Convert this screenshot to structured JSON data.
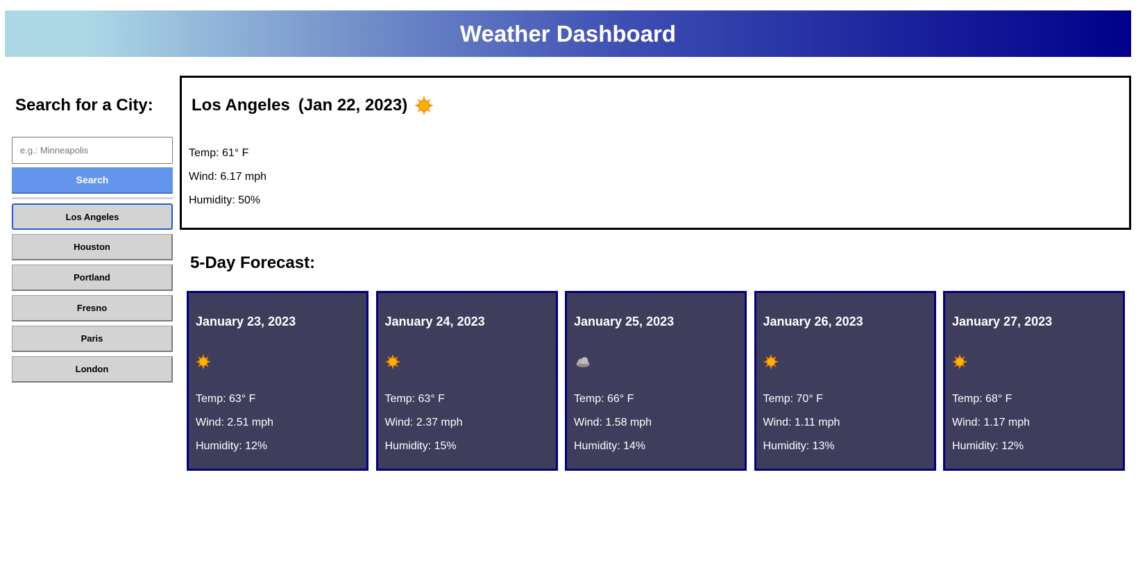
{
  "header": {
    "title": "Weather Dashboard"
  },
  "sidebar": {
    "heading": "Search for a City:",
    "search_placeholder": "e.g.: Minneapolis",
    "search_value": "",
    "search_button": "Search",
    "cities": [
      "Los Angeles",
      "Houston",
      "Portland",
      "Fresno",
      "Paris",
      "London"
    ],
    "active_city": "Los Angeles"
  },
  "current": {
    "city": "Los Angeles",
    "date": "(Jan 22, 2023)",
    "icon": "sun-icon",
    "temp": "Temp: 61° F",
    "wind": "Wind: 6.17 mph",
    "humidity": "Humidity: 50%"
  },
  "forecast": {
    "heading": "5-Day Forecast:",
    "days": [
      {
        "date": "January 23, 2023",
        "icon": "sun-icon",
        "temp": "Temp: 63° F",
        "wind": "Wind: 2.51 mph",
        "humidity": "Humidity: 12%"
      },
      {
        "date": "January 24, 2023",
        "icon": "sun-icon",
        "temp": "Temp: 63° F",
        "wind": "Wind: 2.37 mph",
        "humidity": "Humidity: 15%"
      },
      {
        "date": "January 25, 2023",
        "icon": "cloud-icon",
        "temp": "Temp: 66° F",
        "wind": "Wind: 1.58 mph",
        "humidity": "Humidity: 14%"
      },
      {
        "date": "January 26, 2023",
        "icon": "sun-icon",
        "temp": "Temp: 70° F",
        "wind": "Wind: 1.11 mph",
        "humidity": "Humidity: 13%"
      },
      {
        "date": "January 27, 2023",
        "icon": "sun-icon",
        "temp": "Temp: 68° F",
        "wind": "Wind: 1.17 mph",
        "humidity": "Humidity: 12%"
      }
    ]
  },
  "colors": {
    "search_button": "#6495ed",
    "card_background": "#3e3e5c",
    "card_border": "#000080",
    "header_gradient_start": "#add8e6",
    "header_gradient_end": "#00008b"
  }
}
